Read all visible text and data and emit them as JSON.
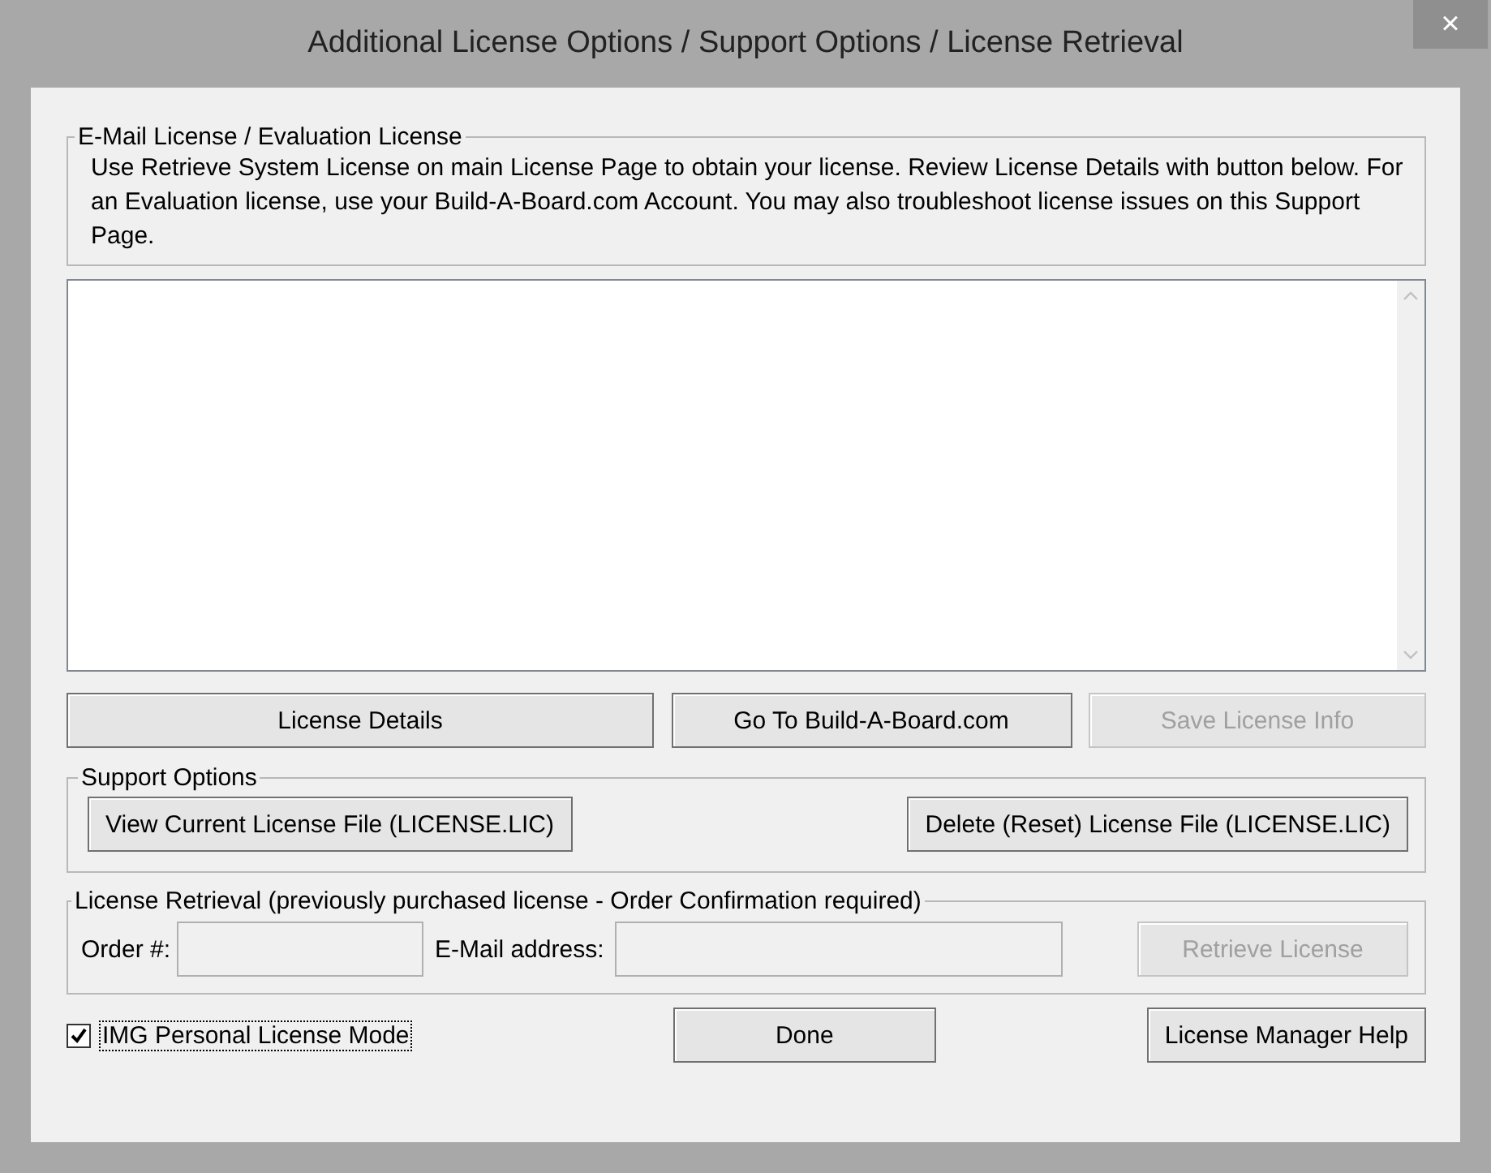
{
  "window": {
    "title": "Additional License Options / Support Options / License Retrieval",
    "close": "×"
  },
  "email_group": {
    "legend": "E-Mail License / Evaluation License",
    "text": "Use Retrieve System License on main License Page to obtain your license.  Review License Details with button below.  For an Evaluation license, use your Build-A-Board.com Account.  You may also troubleshoot license issues on this Support Page."
  },
  "license_buttons": [
    {
      "label": "License Details",
      "disabled": false
    },
    {
      "label": "Go To Build-A-Board.com",
      "disabled": false
    },
    {
      "label": "Save License Info",
      "disabled": true
    }
  ],
  "support_group": {
    "legend": "Support Options",
    "buttons": [
      {
        "label": "View Current License File (LICENSE.LIC)",
        "disabled": false
      },
      {
        "label": "Delete (Reset) License File (LICENSE.LIC)",
        "disabled": false
      }
    ]
  },
  "retrieval_group": {
    "legend": "License Retrieval (previously purchased license - Order Confirmation required)",
    "order_label": "Order #:",
    "order_field": {
      "disabled": true
    },
    "email_label": "E-Mail address:",
    "email_field": {
      "disabled": true
    },
    "button": {
      "label": "Retrieve License",
      "disabled": true
    }
  },
  "personal_mode": {
    "label": "IMG Personal License Mode",
    "checked": true
  },
  "done_button": {
    "label": "Done",
    "disabled": false
  },
  "help_button": {
    "label": "License Manager Help",
    "disabled": false
  }
}
